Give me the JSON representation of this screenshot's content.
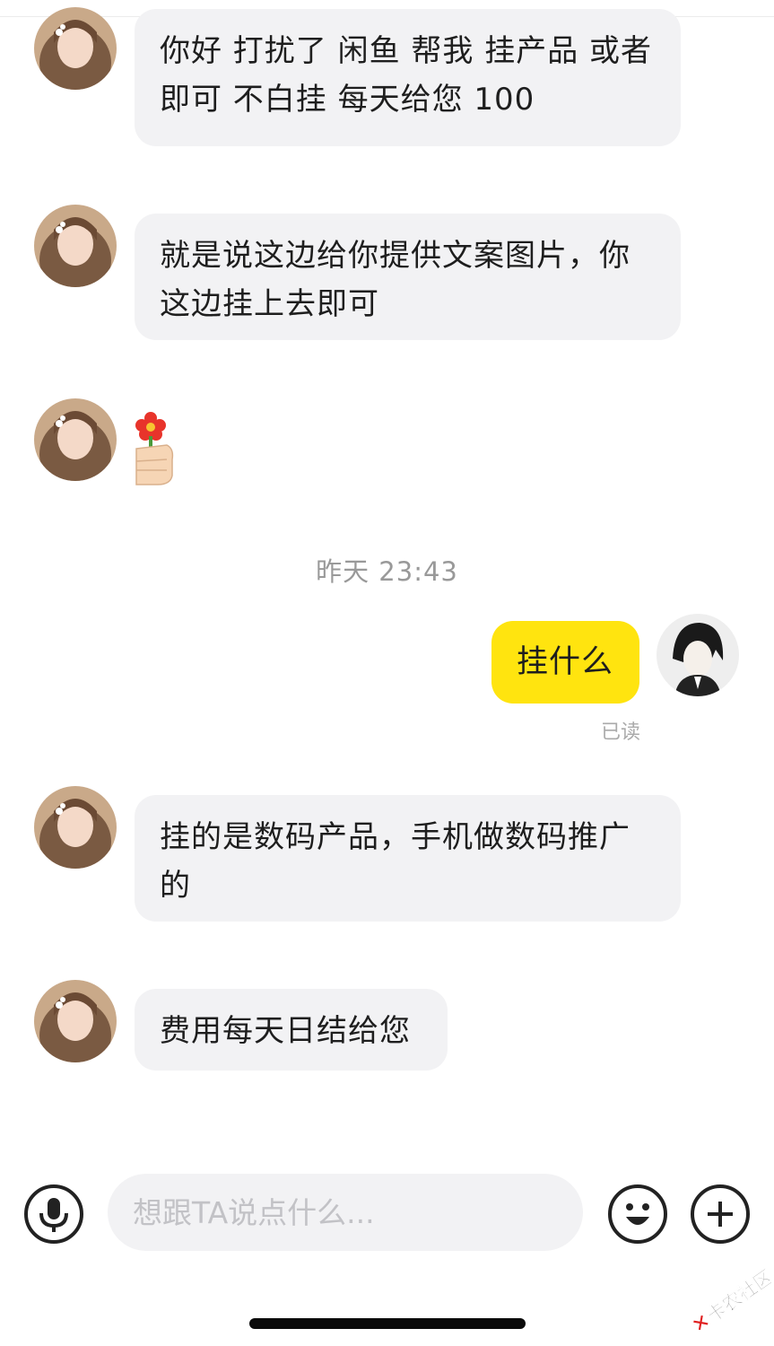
{
  "messages": [
    {
      "side": "left",
      "kind": "text",
      "text": "你好  打扰了 闲鱼 帮我 挂产品  或者即可  不白挂  每天给您 100"
    },
    {
      "side": "left",
      "kind": "text",
      "text": "就是说这边给你提供文案图片，你这边挂上去即可"
    },
    {
      "side": "left",
      "kind": "emoji",
      "icon": "flower-hand-emoji"
    },
    {
      "side": "right",
      "kind": "text",
      "text": "挂什么",
      "status": "已读"
    },
    {
      "side": "left",
      "kind": "text",
      "text": "挂的是数码产品，手机做数码推广的"
    },
    {
      "side": "left",
      "kind": "text",
      "text": "费用每天日结给您"
    }
  ],
  "timestamp": "昨天 23:43",
  "input": {
    "placeholder": "想跟TA说点什么..."
  },
  "icons": {
    "voice": "microphone-icon",
    "emoji": "smiley-icon",
    "more": "plus-icon"
  },
  "watermark": {
    "text": "卡农社区"
  },
  "colors": {
    "my_bubble": "#ffe40f",
    "their_bubble": "#f2f2f4",
    "timestamp": "#999999"
  }
}
